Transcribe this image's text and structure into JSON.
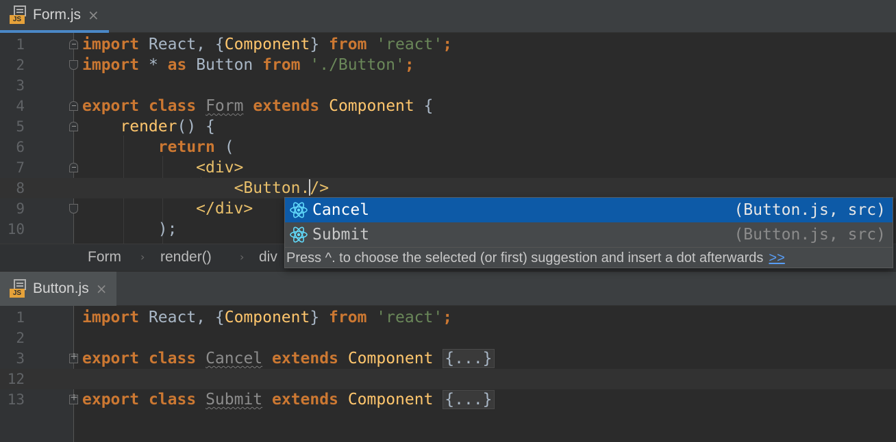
{
  "top_tab": {
    "label": "Form.js",
    "badge": "JS",
    "close": "×"
  },
  "bottom_tab": {
    "label": "Button.js",
    "badge": "JS",
    "close": "×"
  },
  "top_editor": {
    "line_numbers": [
      "1",
      "2",
      "3",
      "4",
      "5",
      "6",
      "7",
      "8",
      "9",
      "10"
    ],
    "l1": {
      "a": "import",
      "b": " React, {",
      "c": "Component",
      "d": "} ",
      "e": "from",
      "f": " ",
      "g": "'react'",
      "h": ";"
    },
    "l2": {
      "a": "import",
      "b": " * ",
      "c": "as",
      "d": " Button ",
      "e": "from",
      "f": " ",
      "g": "'./Button'",
      "h": ";"
    },
    "l4": {
      "a": "export",
      "b": " ",
      "c": "class",
      "d": " ",
      "e": "Form",
      "f": " ",
      "g": "extends",
      "h": " ",
      "i": "Component",
      "j": " {"
    },
    "l5": {
      "a": "render",
      "b": "() {"
    },
    "l6": {
      "a": "return",
      "b": " ("
    },
    "l7": {
      "a": "<div>"
    },
    "l8": {
      "a": "<Button.",
      "b": "/>"
    },
    "l9": {
      "a": "</div>"
    },
    "l10": {
      "a": ");"
    }
  },
  "breadcrumb": {
    "items": [
      "Form",
      "render()",
      "div"
    ],
    "sep": "›"
  },
  "completion": {
    "items": [
      {
        "name": "Cancel",
        "location": "(Button.js, src)"
      },
      {
        "name": "Submit",
        "location": "(Button.js, src)"
      }
    ],
    "hint": "Press ^. to choose the selected (or first) suggestion and insert a dot afterwards",
    "hint_link": ">>"
  },
  "bottom_editor": {
    "line_numbers": [
      "1",
      "2",
      "3",
      "12",
      "13"
    ],
    "l1": {
      "a": "import",
      "b": " React, {",
      "c": "Component",
      "d": "} ",
      "e": "from",
      "f": " ",
      "g": "'react'",
      "h": ";"
    },
    "l3": {
      "a": "export",
      "b": " ",
      "c": "class",
      "d": " ",
      "e": "Cancel",
      "f": " ",
      "g": "extends",
      "h": " ",
      "i": "Component",
      "j": " ",
      "k": "{...}"
    },
    "l13": {
      "a": "export",
      "b": " ",
      "c": "class",
      "d": " ",
      "e": "Submit",
      "f": " ",
      "g": "extends",
      "h": " ",
      "i": "Component",
      "j": " ",
      "k": "{...}"
    }
  },
  "colors": {
    "keyword": "#cc7832",
    "string": "#6a8759",
    "class_name": "#ffc66d",
    "selection": "#0d5aa7",
    "link": "#589df6",
    "react_icon": "#61dafb"
  },
  "icons": {
    "file": "js-file-icon",
    "completion": "react-icon"
  }
}
